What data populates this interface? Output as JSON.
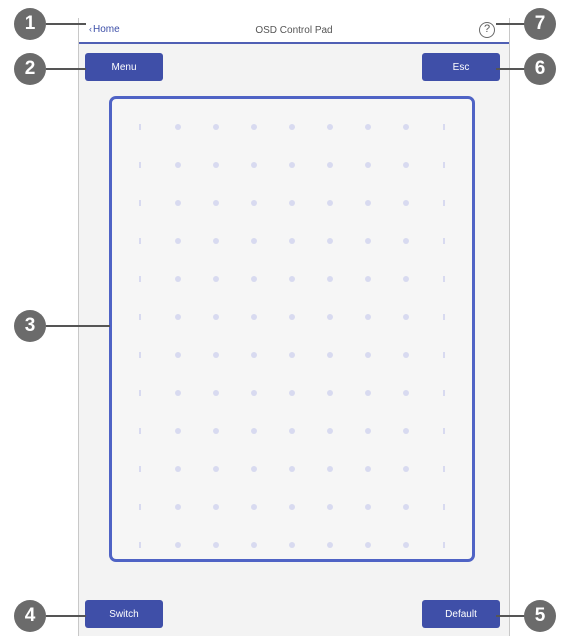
{
  "header": {
    "home_label": "Home",
    "title": "OSD Control Pad",
    "help_symbol": "?"
  },
  "buttons": {
    "menu": "Menu",
    "esc": "Esc",
    "switch": "Switch",
    "default": "Default"
  },
  "callouts": [
    "1",
    "2",
    "3",
    "4",
    "5",
    "6",
    "7"
  ],
  "colors": {
    "accent": "#3f4fa8",
    "pad_border": "#4f63c5",
    "dot": "#d8daf0",
    "callout": "#6b6b6b"
  },
  "icons": {
    "home": "chevron-left-icon",
    "help": "help-circle-icon"
  }
}
